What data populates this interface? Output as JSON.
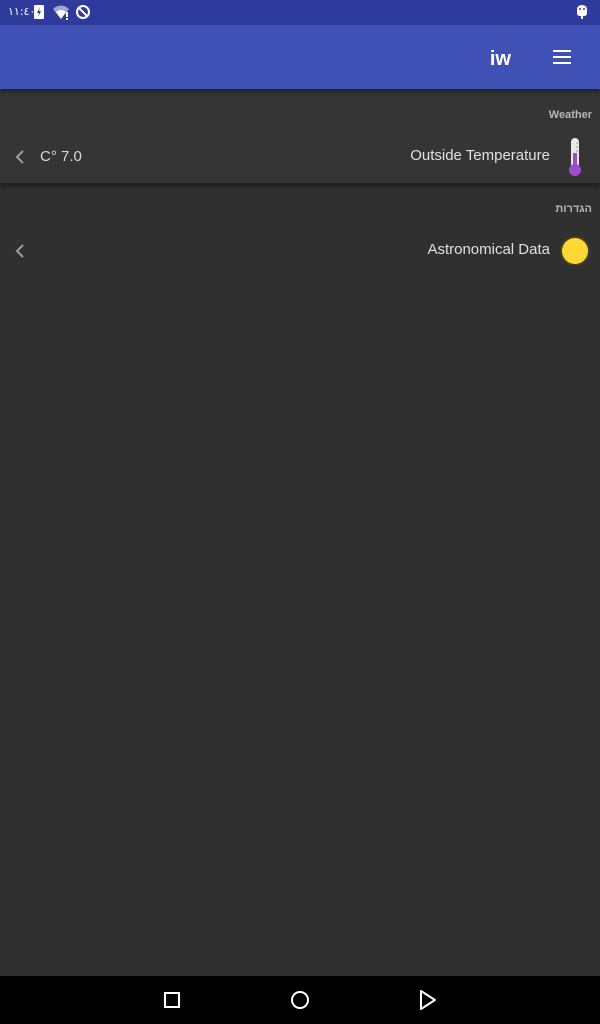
{
  "status_bar": {
    "time": "١١:٤٠"
  },
  "app_bar": {
    "title": "iw",
    "menu_icon": "menu-icon"
  },
  "sections": {
    "weather": {
      "header": "Weather",
      "item": {
        "title": "Outside Temperature",
        "value": "C° 7.0",
        "icon": "thermometer-icon"
      }
    },
    "settings": {
      "header": "הגדרות",
      "item": {
        "title": "Astronomical Data",
        "icon": "sun-icon"
      }
    }
  },
  "colors": {
    "app_bar": "#3f51b5",
    "status_bar": "#2f3b9c",
    "background": "#303030",
    "thermometer": "#9c4dcc",
    "sun": "#fdd835"
  },
  "nav_bar": {
    "buttons": [
      "recents-icon",
      "home-icon",
      "back-icon"
    ]
  }
}
